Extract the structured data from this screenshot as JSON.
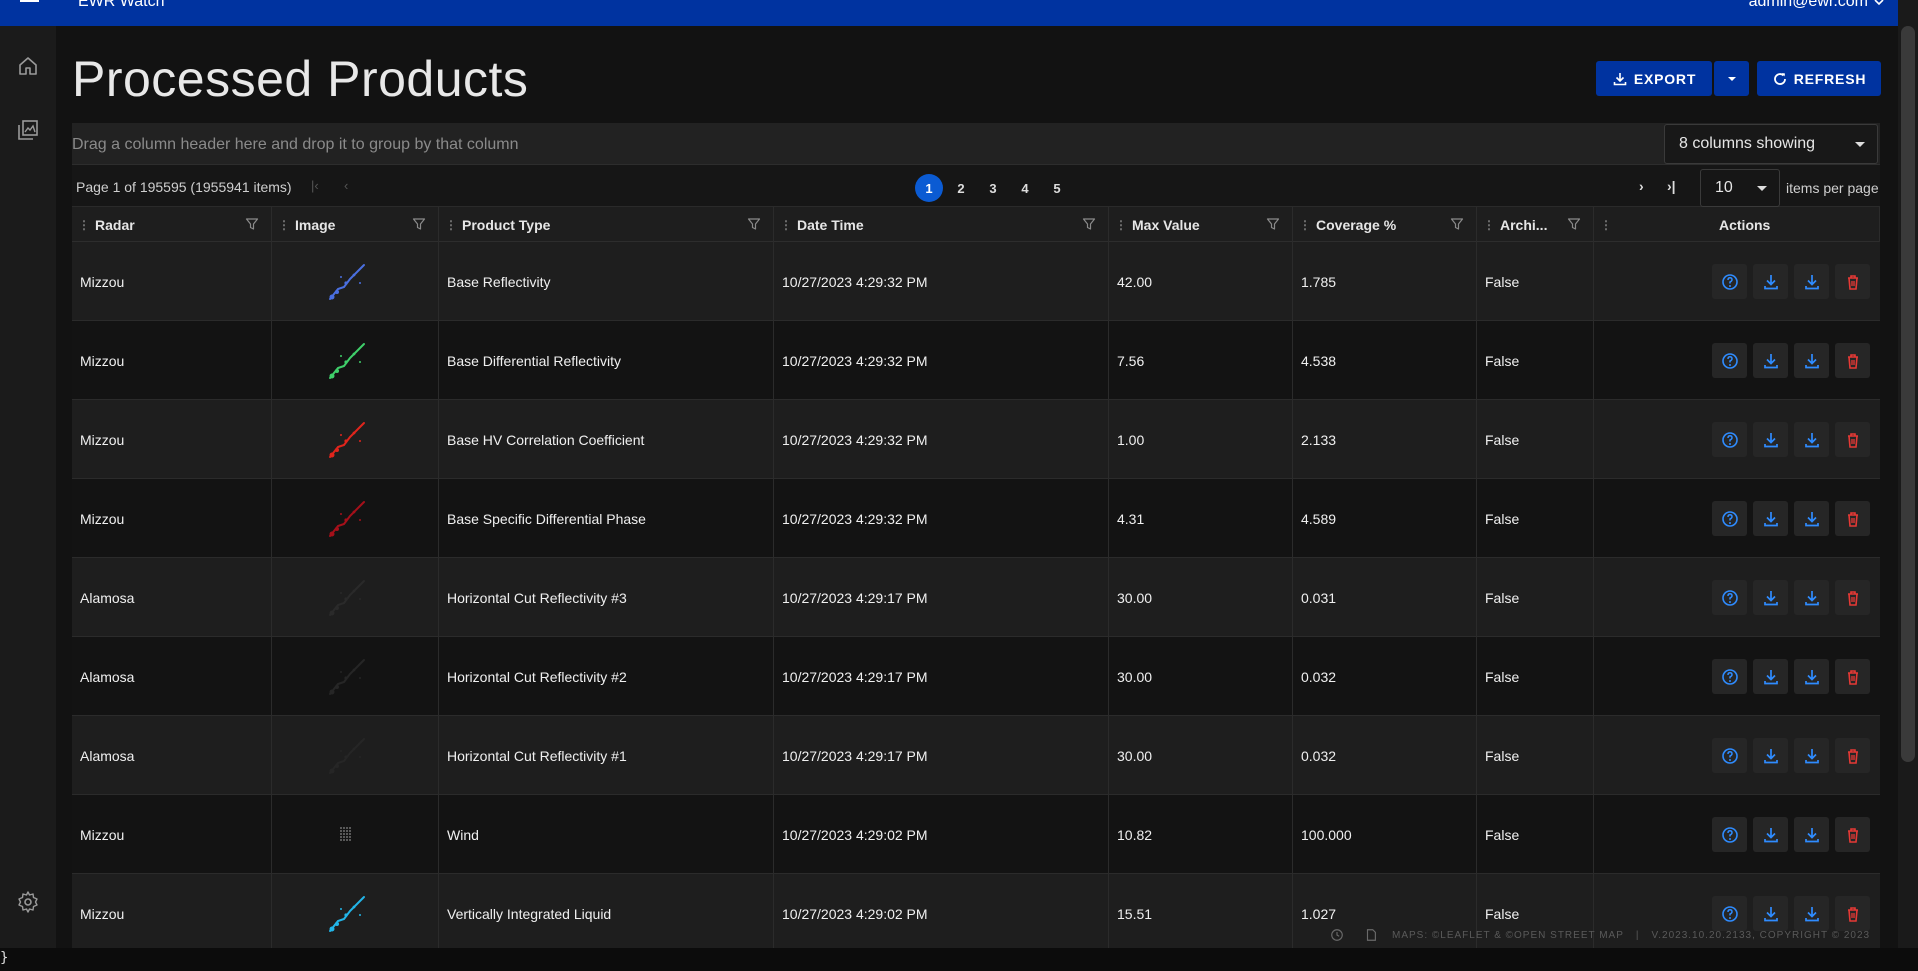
{
  "app": {
    "title": "EWR Watch",
    "user": "admin@ewr.com"
  },
  "sidebar": {
    "items": [
      {
        "name": "home-icon"
      },
      {
        "name": "gallery-icon"
      },
      {
        "name": "gear-icon"
      }
    ]
  },
  "page": {
    "title": "Processed Products"
  },
  "toolbar": {
    "export_label": "EXPORT",
    "refresh_label": "REFRESH"
  },
  "grid": {
    "group_hint": "Drag a column header here and drop it to group by that column",
    "columns_showing": "8 columns showing",
    "pager": {
      "info": "Page 1 of 195595 (1955941 items)",
      "pages": [
        "1",
        "2",
        "3",
        "4",
        "5"
      ],
      "active_page": "1",
      "per_page": "10",
      "per_page_label": "items per page"
    },
    "columns": [
      "Radar",
      "Image",
      "Product Type",
      "Date Time",
      "Max Value",
      "Coverage %",
      "Archi...",
      "Actions"
    ],
    "rows": [
      {
        "radar": "Mizzou",
        "image_color": "#4a6fe0",
        "product": "Base Reflectivity",
        "datetime": "10/27/2023 4:29:32 PM",
        "max": "42.00",
        "coverage": "1.785",
        "archived": "False"
      },
      {
        "radar": "Mizzou",
        "image_color": "#3fcf6a",
        "product": "Base Differential Reflectivity",
        "datetime": "10/27/2023 4:29:32 PM",
        "max": "7.56",
        "coverage": "4.538",
        "archived": "False"
      },
      {
        "radar": "Mizzou",
        "image_color": "#e0251c",
        "product": "Base HV Correlation Coefficient",
        "datetime": "10/27/2023 4:29:32 PM",
        "max": "1.00",
        "coverage": "2.133",
        "archived": "False"
      },
      {
        "radar": "Mizzou",
        "image_color": "#a5101a",
        "product": "Base Specific Differential Phase",
        "datetime": "10/27/2023 4:29:32 PM",
        "max": "4.31",
        "coverage": "4.589",
        "archived": "False"
      },
      {
        "radar": "Alamosa",
        "image_color": "#2a2a2a",
        "product": "Horizontal Cut Reflectivity #3",
        "datetime": "10/27/2023 4:29:17 PM",
        "max": "30.00",
        "coverage": "0.031",
        "archived": "False"
      },
      {
        "radar": "Alamosa",
        "image_color": "#262626",
        "product": "Horizontal Cut Reflectivity #2",
        "datetime": "10/27/2023 4:29:17 PM",
        "max": "30.00",
        "coverage": "0.032",
        "archived": "False"
      },
      {
        "radar": "Alamosa",
        "image_color": "#262626",
        "product": "Horizontal Cut Reflectivity #1",
        "datetime": "10/27/2023 4:29:17 PM",
        "max": "30.00",
        "coverage": "0.032",
        "archived": "False"
      },
      {
        "radar": "Mizzou",
        "image_color": "#8a8a8a",
        "product": "Wind",
        "datetime": "10/27/2023 4:29:02 PM",
        "max": "10.82",
        "coverage": "100.000",
        "archived": "False"
      },
      {
        "radar": "Mizzou",
        "image_color": "#22b5e8",
        "product": "Vertically Integrated Liquid",
        "datetime": "10/27/2023 4:29:02 PM",
        "max": "15.51",
        "coverage": "1.027",
        "archived": "False"
      }
    ]
  },
  "footer": {
    "maps_credit": "MAPS: ©LEAFLET & ©OPEN STREET MAP",
    "separator": "|",
    "version": "V.2023.10.20.2133, COPYRIGHT © 2023"
  },
  "stray": "}",
  "colors": {
    "appbar": "#0033a0",
    "accent": "#0b5bd3",
    "action_blue": "#2f8cff",
    "delete_red": "#e53935"
  }
}
